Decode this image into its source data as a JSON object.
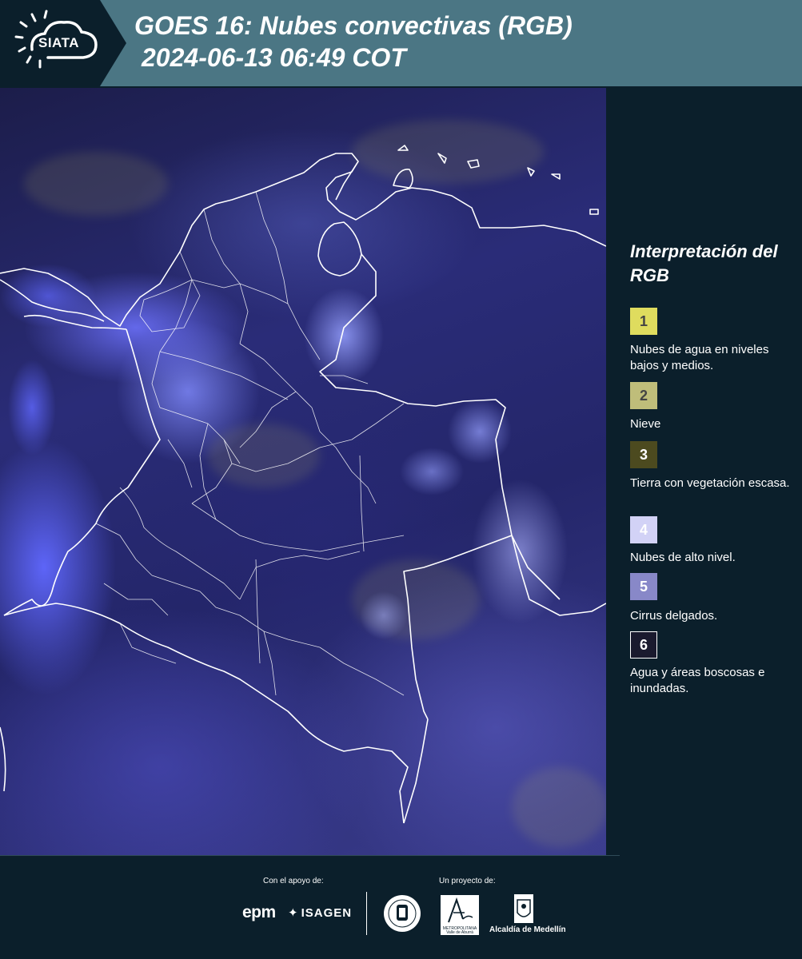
{
  "header": {
    "logo_text": "SIATA",
    "title_line1": "GOES 16: Nubes convectivas (RGB)",
    "title_line2": "2024-06-13 06:49 COT"
  },
  "legend": {
    "title": "Interpretación del RGB",
    "items": [
      {
        "number": "1",
        "label": "Nubes de agua en niveles bajos y medios.",
        "color": "#dfdc5e"
      },
      {
        "number": "2",
        "label": "Nieve",
        "color": "#bfbd7a"
      },
      {
        "number": "3",
        "label": "Tierra con vegetación escasa.",
        "color": "#4c4a1f"
      },
      {
        "number": "4",
        "label": "Nubes de alto nivel.",
        "color": "#d2d2f6"
      },
      {
        "number": "5",
        "label": "Cirrus delgados.",
        "color": "#8888c8"
      },
      {
        "number": "6",
        "label": "Agua y áreas boscosas e inundadas.",
        "color": "#1a1a2e"
      }
    ]
  },
  "footer": {
    "support_label": "Con el apoyo de:",
    "project_label": "Un proyecto de:",
    "sponsors": [
      "epm",
      "ISAGEN"
    ],
    "area_text": "METROPOLITANA Valle de Aburrá",
    "alcaldia": "Alcaldía de Medellín"
  },
  "colors": {
    "header_bg": "#4b7684",
    "panel_bg": "#0b1f2b",
    "map_base": "#2a2c78",
    "cloud_blue": "#6068ff"
  }
}
